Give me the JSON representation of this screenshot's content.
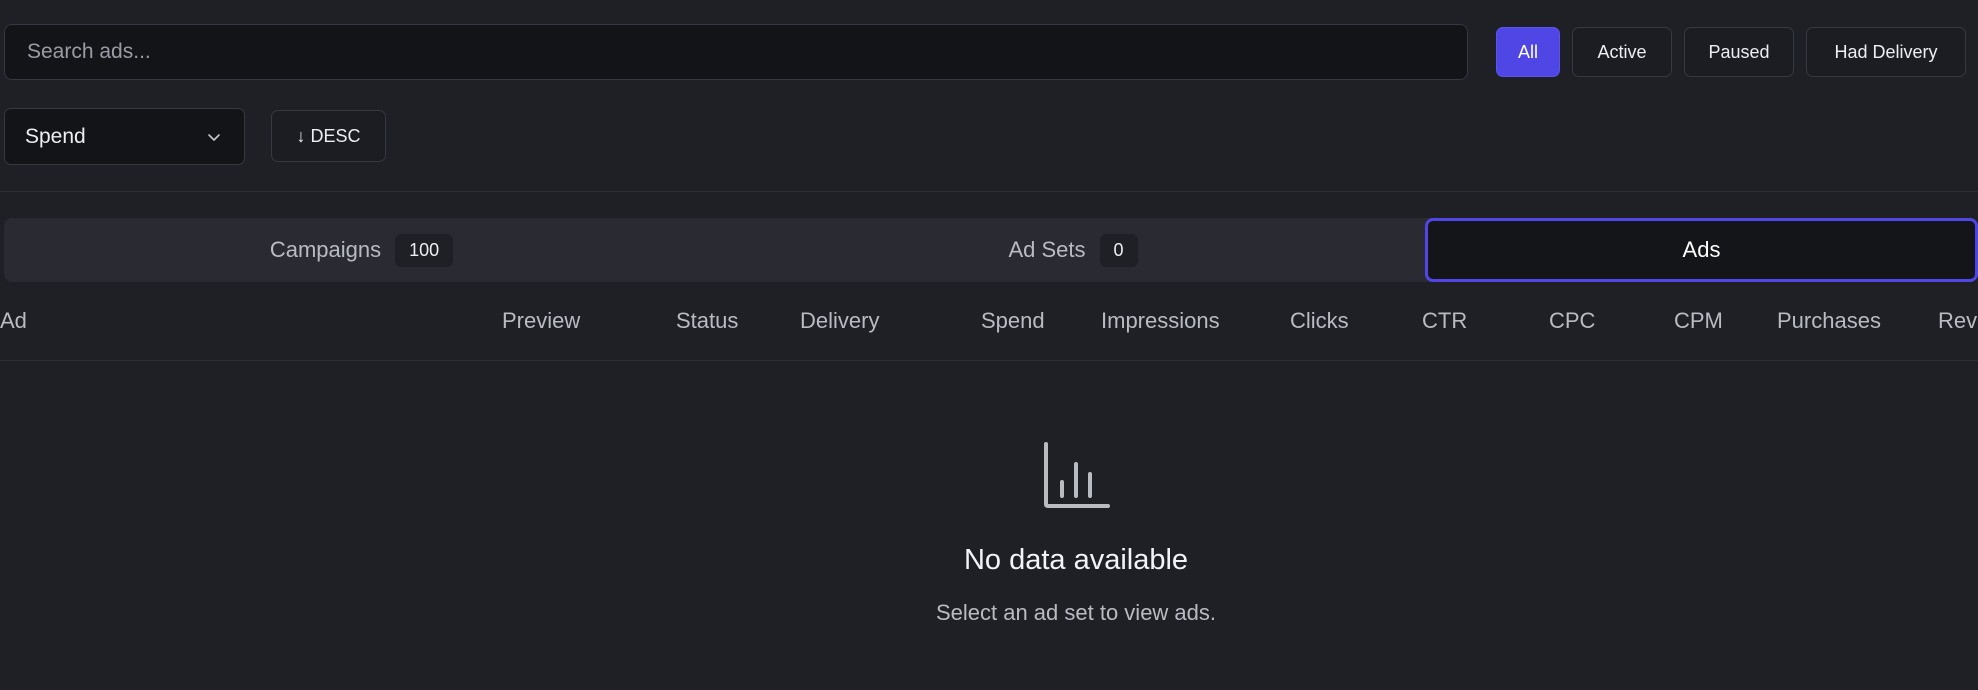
{
  "search": {
    "placeholder": "Search ads..."
  },
  "status_filters": [
    "All",
    "Active",
    "Paused",
    "Had Delivery"
  ],
  "selected_status_filter": "All",
  "sort": {
    "field": "Spend",
    "order_label": "↓ DESC"
  },
  "tabs": [
    {
      "label": "Campaigns",
      "count": "100"
    },
    {
      "label": "Ad Sets",
      "count": "0"
    },
    {
      "label": "Ads",
      "count": null
    }
  ],
  "active_tab": "Ads",
  "table": {
    "columns": [
      "Ad",
      "Preview",
      "Status",
      "Delivery",
      "Spend",
      "Impressions",
      "Clicks",
      "CTR",
      "CPC",
      "CPM",
      "Purchases",
      "Rev"
    ]
  },
  "empty_state": {
    "icon": "bar-chart-icon",
    "title": "No data available",
    "subtitle": "Select an ad set to view ads."
  },
  "colors": {
    "background": "#1f2026",
    "accent": "#4f46e5"
  }
}
